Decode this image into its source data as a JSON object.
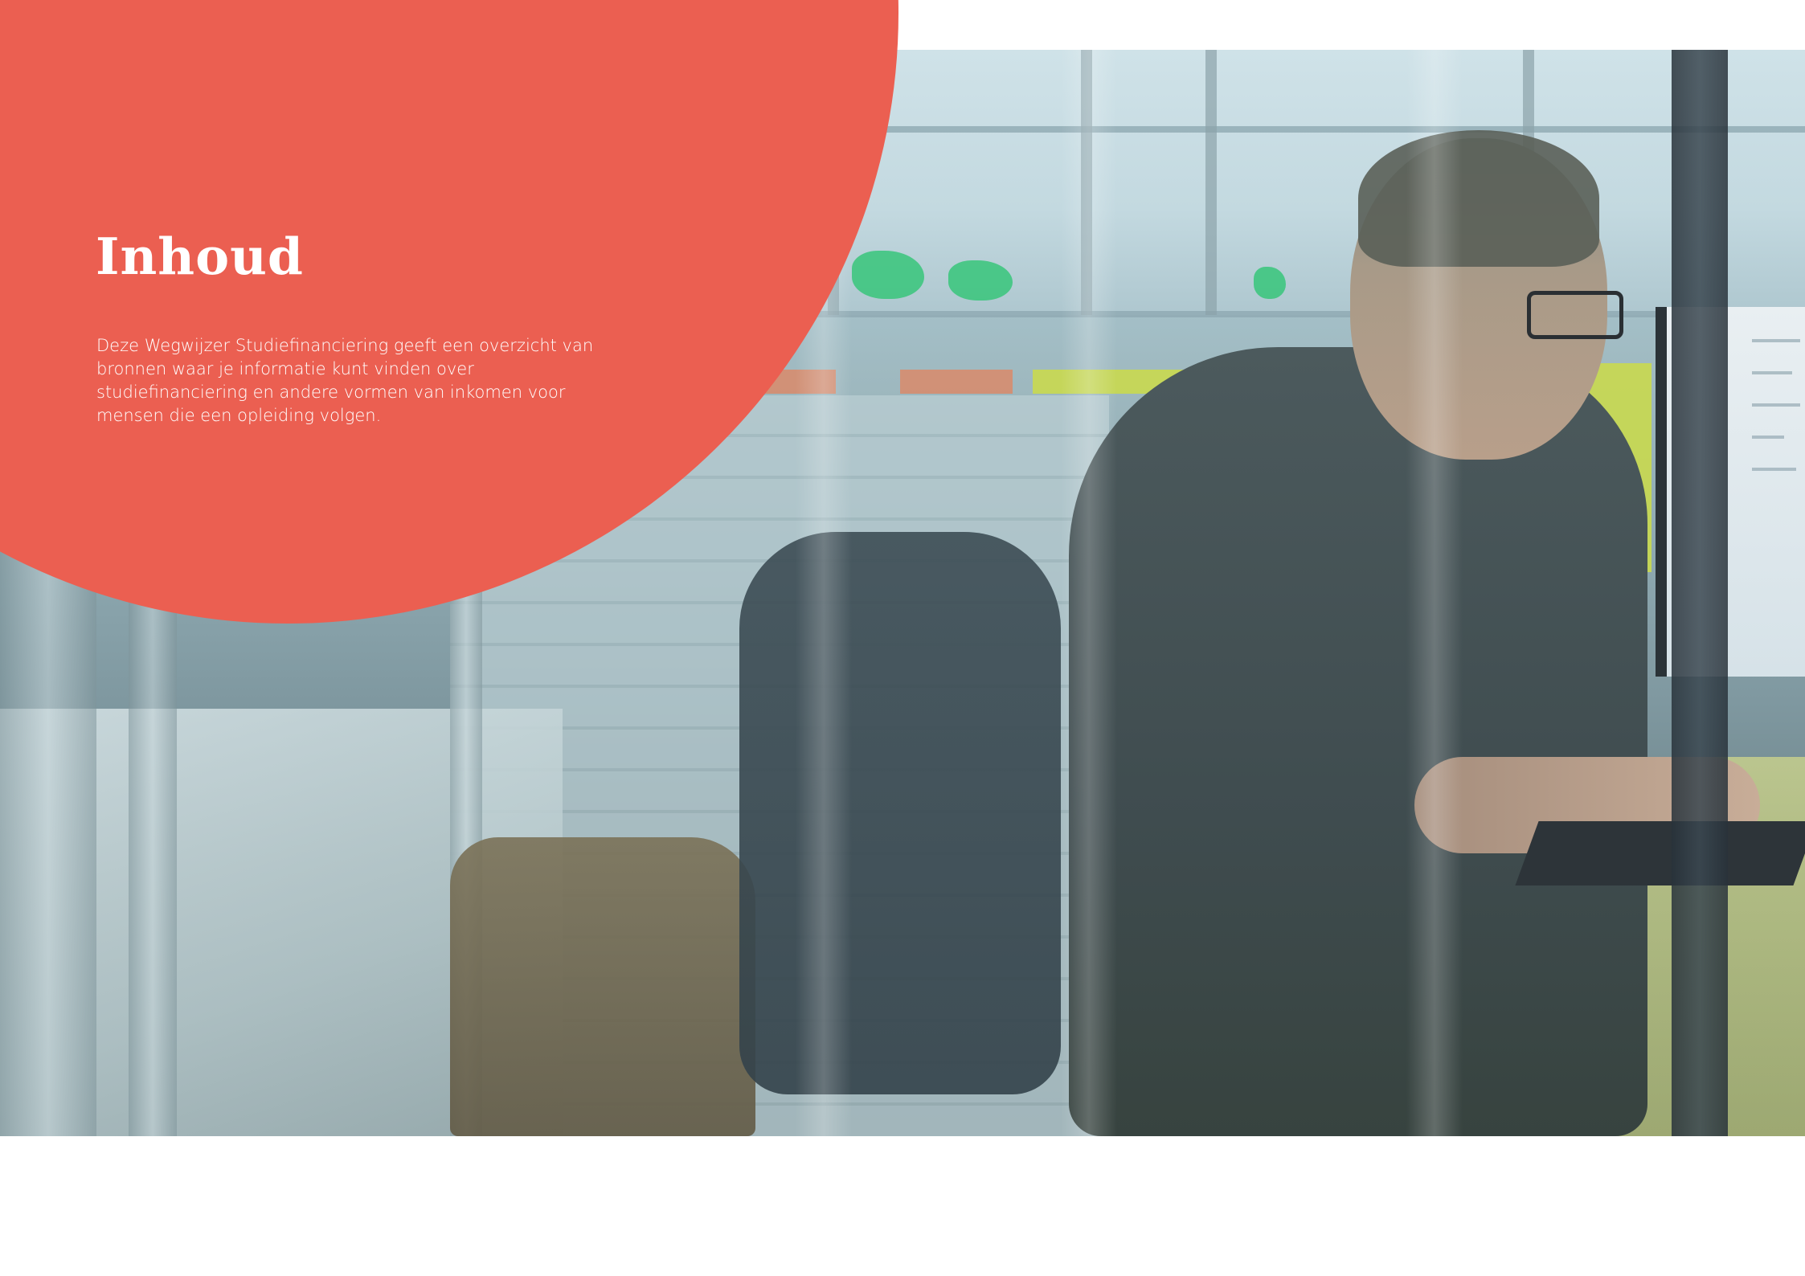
{
  "page": {
    "title": "Inhoud",
    "intro": "Deze Wegwijzer Studiefinanciering geeft een overzicht van bronnen waar je informatie kunt vinden over studiefinanciering en andere vormen van inkomen voor mensen die een opleiding volgen."
  },
  "colors": {
    "accent_circle": "#eb5f51",
    "text_on_accent": "#ffffff",
    "background": "#ffffff"
  }
}
